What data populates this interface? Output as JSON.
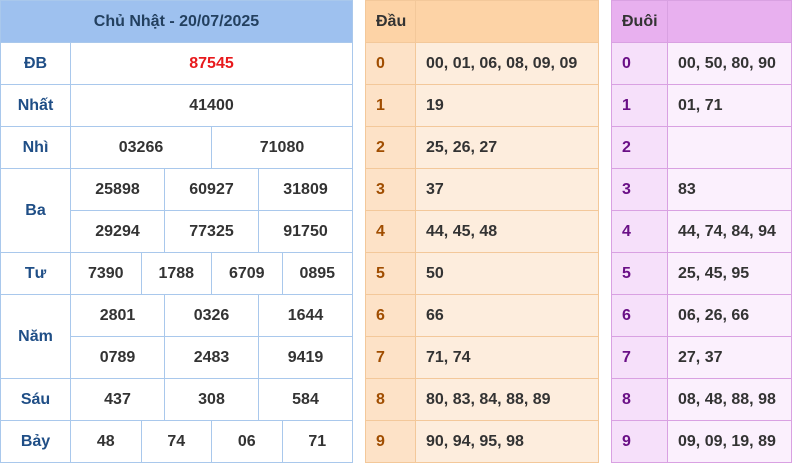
{
  "results": {
    "title": "Chủ Nhật - 20/07/2025",
    "prizes": {
      "db": {
        "label": "ĐB",
        "numbers": [
          "87545"
        ]
      },
      "nhat": {
        "label": "Nhất",
        "numbers": [
          "41400"
        ]
      },
      "nhi": {
        "label": "Nhì",
        "numbers": [
          "03266",
          "71080"
        ]
      },
      "ba": {
        "label": "Ba",
        "numbers": [
          "25898",
          "60927",
          "31809",
          "29294",
          "77325",
          "91750"
        ]
      },
      "tu": {
        "label": "Tư",
        "numbers": [
          "7390",
          "1788",
          "6709",
          "0895"
        ]
      },
      "nam": {
        "label": "Năm",
        "numbers": [
          "2801",
          "0326",
          "1644",
          "0789",
          "2483",
          "9419"
        ]
      },
      "sau": {
        "label": "Sáu",
        "numbers": [
          "437",
          "308",
          "584"
        ]
      },
      "bay": {
        "label": "Bảy",
        "numbers": [
          "48",
          "74",
          "06",
          "71"
        ]
      }
    }
  },
  "dau": {
    "header": "Đầu",
    "rows": [
      {
        "digit": "0",
        "values": "00, 01, 06, 08, 09, 09"
      },
      {
        "digit": "1",
        "values": "19"
      },
      {
        "digit": "2",
        "values": "25, 26, 27"
      },
      {
        "digit": "3",
        "values": "37"
      },
      {
        "digit": "4",
        "values": "44, 45, 48"
      },
      {
        "digit": "5",
        "values": "50"
      },
      {
        "digit": "6",
        "values": "66"
      },
      {
        "digit": "7",
        "values": "71, 74"
      },
      {
        "digit": "8",
        "values": "80, 83, 84, 88, 89"
      },
      {
        "digit": "9",
        "values": "90, 94, 95, 98"
      }
    ]
  },
  "duoi": {
    "header": "Đuôi",
    "rows": [
      {
        "digit": "0",
        "values": "00, 50, 80, 90"
      },
      {
        "digit": "1",
        "values": "01, 71"
      },
      {
        "digit": "2",
        "values": ""
      },
      {
        "digit": "3",
        "values": "83"
      },
      {
        "digit": "4",
        "values": "44, 74, 84, 94"
      },
      {
        "digit": "5",
        "values": "25, 45, 95"
      },
      {
        "digit": "6",
        "values": "06, 26, 66"
      },
      {
        "digit": "7",
        "values": "27, 37"
      },
      {
        "digit": "8",
        "values": "08, 48, 88, 98"
      },
      {
        "digit": "9",
        "values": "09, 09, 19, 89"
      }
    ]
  }
}
